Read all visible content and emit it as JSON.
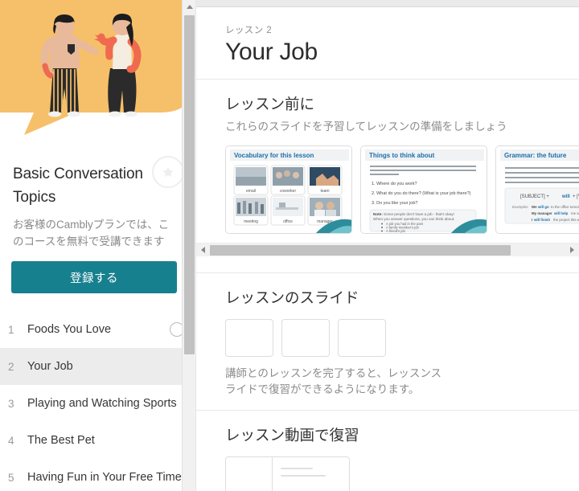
{
  "sidebar": {
    "hero_illustration": "two-people-talking-speech-bubble",
    "course_title": "Basic Conversation Topics",
    "favorite_icon": "star-icon",
    "course_description": "お客様のCamblyプランでは、このコースを無料で受講できます",
    "enroll_label": "登録する",
    "lessons": [
      {
        "num": "1",
        "name": "Foods You Love",
        "status": "incomplete",
        "active": false
      },
      {
        "num": "2",
        "name": "Your Job",
        "status": "none",
        "active": true
      },
      {
        "num": "3",
        "name": "Playing and Watching Sports",
        "status": "none",
        "active": false
      },
      {
        "num": "4",
        "name": "The Best Pet",
        "status": "none",
        "active": false
      },
      {
        "num": "5",
        "name": "Having Fun in Your Free Time",
        "status": "none",
        "active": false
      }
    ],
    "scrollbar": {
      "up_arrow_icon": "triangle-up-icon"
    }
  },
  "main": {
    "kicker": "レッスン 2",
    "title": "Your Job",
    "before_lesson": {
      "heading": "レッスン前に",
      "subheading": "これらのスライドを予習してレッスンの準備をしましょう",
      "slides": [
        {
          "title": "Vocabulary for this lesson",
          "type": "vocabulary-grid",
          "words": [
            "email",
            "coworker",
            "team",
            "meeting",
            "office",
            "manager"
          ]
        },
        {
          "title": "Things to think about",
          "type": "questions",
          "intro": "At the beginning of the lesson, your tutor will ask you the following questions as a warm-up exercise. We recommend writing out your answers ahead of time for extra practice.",
          "questions": [
            "1. Where do you work?",
            "2. What do you do there? (What is your job there?)",
            "3. Do you like your job?"
          ],
          "note_label": "Note:",
          "note_text": "Some people don't have a job - that's okay! When you answer questions, you can think about:",
          "note_bullets": [
            "A job you had in the past",
            "A family member's job",
            "A friend's job"
          ]
        },
        {
          "title": "Grammar: the future",
          "type": "grammar",
          "body": "Use the word will to talk about things that will happen in the future. To make a sentence, combine will with the base form of a verb. The base form of a verb is the infinitive without the word to. Before your lesson, try writing 3 examples.",
          "formula": "[SUBJECT]  +  will  +  [VERB]",
          "examples_label": "Examples:",
          "examples": [
            "We will go to the office tomorrow.",
            "My manager will help me with the report.",
            "I will finish the project this week."
          ]
        }
      ],
      "scrollbar": {
        "left_arrow_icon": "triangle-left-icon",
        "right_arrow_icon": "triangle-right-icon"
      }
    },
    "lesson_slides": {
      "heading": "レッスンのスライド",
      "note": "講師とのレッスンを完了すると、レッスンスライドで復習ができるようになります。",
      "placeholder_count": 3
    },
    "lesson_video": {
      "heading": "レッスン動画で復習",
      "placeholder_count": 1
    }
  },
  "colors": {
    "accent_teal": "#17808f",
    "hero_orange": "#f6c06a",
    "active_row": "#ececec",
    "scrollbar_thumb": "#c1c1c1",
    "slide_header_blue": "#1b6fa8"
  }
}
